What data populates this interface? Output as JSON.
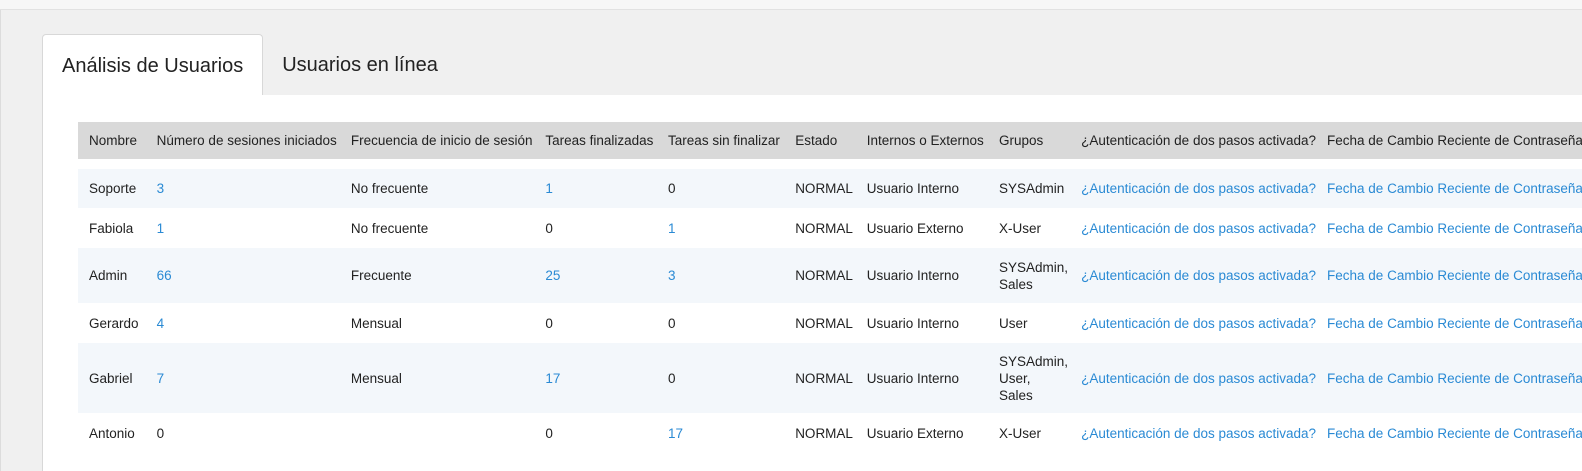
{
  "tabs": [
    {
      "label": "Análisis de Usuarios",
      "active": true
    },
    {
      "label": "Usuarios en línea",
      "active": false
    }
  ],
  "table": {
    "headers": [
      "Nombre",
      "Número de sesiones iniciados",
      "Frecuencia de inicio de sesión",
      "Tareas finalizadas",
      "Tareas sin finalizar",
      "Estado",
      "Internos o Externos",
      "Grupos",
      "¿Autenticación de dos pasos activada?",
      "Fecha de Cambio Reciente de Contraseña"
    ],
    "rows": [
      {
        "nombre": "Soporte",
        "sesiones": "3",
        "frecuencia": "No frecuente",
        "finalizadas": "1",
        "sin_finalizar": "0",
        "estado": "NORMAL",
        "tipo": "Usuario Interno",
        "grupos": "SYSAdmin",
        "autenticacion": "¿Autenticación de dos pasos activada?",
        "fecha": "Fecha de Cambio Reciente de Contraseña"
      },
      {
        "nombre": "Fabiola",
        "sesiones": "1",
        "frecuencia": "No frecuente",
        "finalizadas": "0",
        "sin_finalizar": "1",
        "estado": "NORMAL",
        "tipo": "Usuario Externo",
        "grupos": "X-User",
        "autenticacion": "¿Autenticación de dos pasos activada?",
        "fecha": "Fecha de Cambio Reciente de Contraseña"
      },
      {
        "nombre": "Admin",
        "sesiones": "66",
        "frecuencia": "Frecuente",
        "finalizadas": "25",
        "sin_finalizar": "3",
        "estado": "NORMAL",
        "tipo": "Usuario Interno",
        "grupos": "SYSAdmin,\nSales",
        "autenticacion": "¿Autenticación de dos pasos activada?",
        "fecha": "Fecha de Cambio Reciente de Contraseña"
      },
      {
        "nombre": "Gerardo",
        "sesiones": "4",
        "frecuencia": "Mensual",
        "finalizadas": "0",
        "sin_finalizar": "0",
        "estado": "NORMAL",
        "tipo": "Usuario Interno",
        "grupos": "User",
        "autenticacion": "¿Autenticación de dos pasos activada?",
        "fecha": "Fecha de Cambio Reciente de Contraseña"
      },
      {
        "nombre": "Gabriel",
        "sesiones": "7",
        "frecuencia": "Mensual",
        "finalizadas": "17",
        "sin_finalizar": "0",
        "estado": "NORMAL",
        "tipo": "Usuario Interno",
        "grupos": "SYSAdmin,\nUser,\nSales",
        "autenticacion": "¿Autenticación de dos pasos activada?",
        "fecha": "Fecha de Cambio Reciente de Contraseña"
      },
      {
        "nombre": "Antonio",
        "sesiones": "0",
        "frecuencia": "",
        "finalizadas": "0",
        "sin_finalizar": "17",
        "estado": "NORMAL",
        "tipo": "Usuario Externo",
        "grupos": "X-User",
        "autenticacion": "¿Autenticación de dos pasos activada?",
        "fecha": "Fecha de Cambio Reciente de Contraseña"
      }
    ]
  },
  "colors": {
    "link": "#2a8ad4",
    "header_bg": "#d9d9d9",
    "stripe": "#f3f7fb"
  }
}
